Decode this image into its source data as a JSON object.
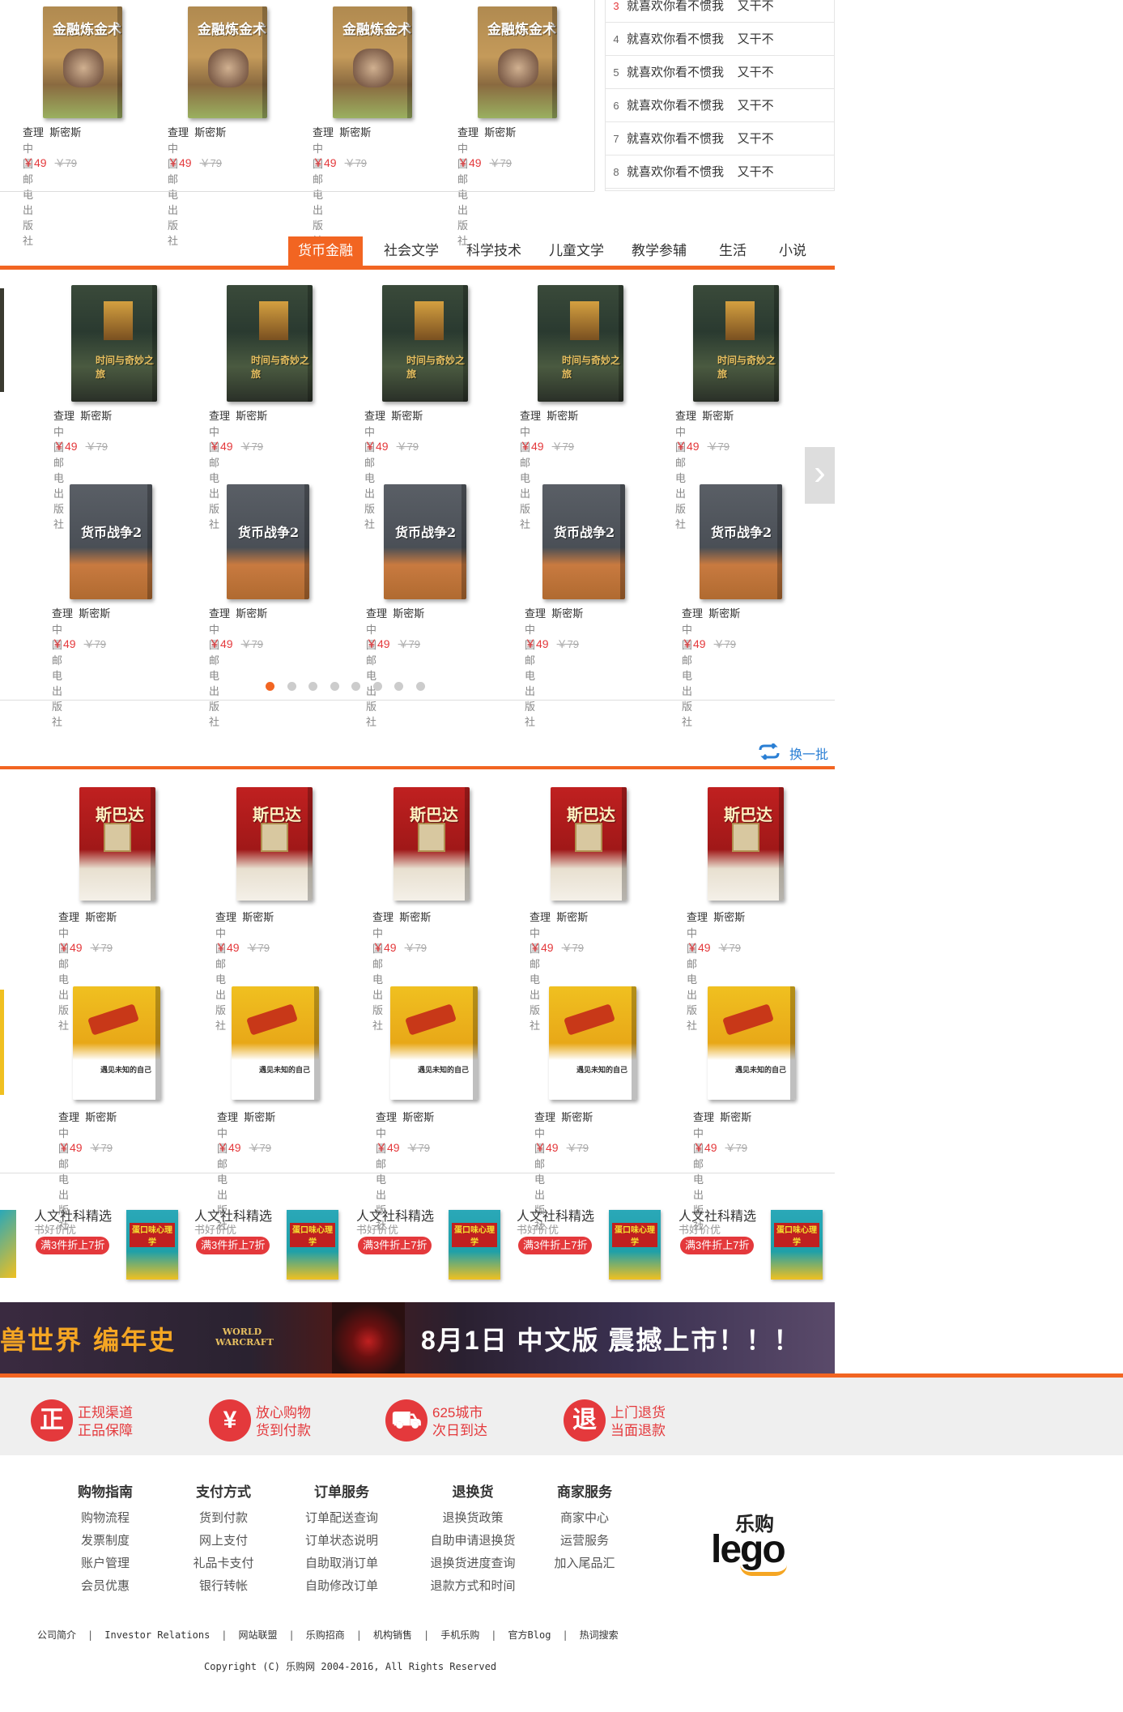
{
  "top_books": [
    {
      "title": "金融炼金术",
      "author": "查理  斯密斯",
      "publisher": "中国邮电出版社",
      "price": "￥49",
      "old_price": "￥79"
    },
    {
      "title": "金融炼金术",
      "author": "查理  斯密斯",
      "publisher": "中国邮电出版社",
      "price": "￥49",
      "old_price": "￥79"
    },
    {
      "title": "金融炼金术",
      "author": "查理  斯密斯",
      "publisher": "中国邮电出版社",
      "price": "￥49",
      "old_price": "￥79"
    },
    {
      "title": "金融炼金术",
      "author": "查理  斯密斯",
      "publisher": "中国邮电出版社",
      "price": "￥49",
      "old_price": "￥79"
    }
  ],
  "ranking": [
    {
      "n": "3",
      "text": "就喜欢你看不惯我    又干不"
    },
    {
      "n": "4",
      "text": "就喜欢你看不惯我    又干不"
    },
    {
      "n": "5",
      "text": "就喜欢你看不惯我    又干不"
    },
    {
      "n": "6",
      "text": "就喜欢你看不惯我    又干不"
    },
    {
      "n": "7",
      "text": "就喜欢你看不惯我    又干不"
    },
    {
      "n": "8",
      "text": "就喜欢你看不惯我    又干不"
    }
  ],
  "tabs": [
    "货币金融",
    "社会文学",
    "科学技术",
    "儿童文学",
    "教学参辅",
    "生活",
    "小说"
  ],
  "carousel_row1": {
    "title": "时间与奇妙之旅",
    "author": "查理  斯密斯",
    "publisher": "中国邮电出版社",
    "price": "￥49",
    "old_price": "￥79"
  },
  "carousel_row2": {
    "title": "货币战争2",
    "author": "查理  斯密斯",
    "publisher": "中国邮电出版社",
    "price": "￥49",
    "old_price": "￥79"
  },
  "carousel_arrow": "›",
  "refresh_label": "换一批",
  "grid_row1": {
    "title": "斯巴达",
    "author": "查理  斯密斯",
    "publisher": "中国邮电出版社",
    "price": "￥49",
    "old_price": "￥79"
  },
  "grid_row2": {
    "title": "遇见未知的自己",
    "author": "查理  斯密斯",
    "publisher": "中国邮电出版社",
    "price": "￥49",
    "old_price": "￥79"
  },
  "promos": {
    "title": "人文社科精选",
    "sub": "书好价优",
    "badge": "满3件折上7折",
    "book": "蛋口味心理学"
  },
  "banner": {
    "left": "兽世界  编年史",
    "logo": "WORLD WARCRAFT",
    "right": "8月1日  中文版  震撼上市！！！"
  },
  "services": [
    {
      "icon": "正",
      "l1": "正规渠道",
      "l2": "正品保障"
    },
    {
      "icon": "¥",
      "l1": "放心购物",
      "l2": "货到付款"
    },
    {
      "icon": "⛟",
      "l1": "625城市",
      "l2": "次日到达"
    },
    {
      "icon": "退",
      "l1": "上门退货",
      "l2": "当面退款"
    }
  ],
  "footer_cols": [
    {
      "h": "购物指南",
      "items": [
        "购物流程",
        "发票制度",
        "账户管理",
        "会员优惠"
      ]
    },
    {
      "h": "支付方式",
      "items": [
        "货到付款",
        "网上支付",
        "礼品卡支付",
        "银行转帐"
      ]
    },
    {
      "h": "订单服务",
      "items": [
        "订单配送查询",
        "订单状态说明",
        "自助取消订单",
        "自助修改订单"
      ]
    },
    {
      "h": "退换货",
      "items": [
        "退换货政策",
        "自助申请退换货",
        "退换货进度查询",
        "退款方式和时间"
      ]
    },
    {
      "h": "商家服务",
      "items": [
        "商家中心",
        "运营服务",
        "加入尾品汇"
      ]
    }
  ],
  "logo": {
    "top": "乐购",
    "bottom": "lego"
  },
  "bottom_links": [
    "公司简介",
    "Investor Relations",
    "网站联盟",
    "乐购招商",
    "机构销售",
    "手机乐购",
    "官方Blog",
    "热词搜索"
  ],
  "copyright": "Copyright (C) 乐购网 2004-2016, All Rights Reserved",
  "colors": {
    "accent": "#f26522",
    "price": "#e4393c"
  }
}
